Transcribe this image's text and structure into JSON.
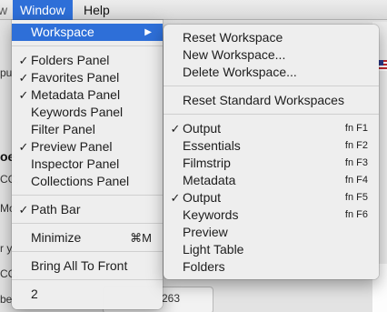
{
  "menubar": {
    "partial_item": "w",
    "items": [
      {
        "label": "Window"
      },
      {
        "label": "Help"
      }
    ]
  },
  "background": {
    "frag1": "pu",
    "frag2": "oe",
    "frag3": "CC,",
    "frag4": "Mo",
    "frag5": "r y",
    "frag6": "CC,",
    "frag7": "be",
    "frag8": "263",
    "frag9": "- - -"
  },
  "window_menu": {
    "items": [
      {
        "label": "Workspace",
        "checked": false,
        "shortcut": "",
        "submenu": true,
        "highlight": true
      },
      {
        "label": "Folders Panel",
        "checked": true,
        "shortcut": ""
      },
      {
        "label": "Favorites Panel",
        "checked": true,
        "shortcut": ""
      },
      {
        "label": "Metadata Panel",
        "checked": true,
        "shortcut": ""
      },
      {
        "label": "Keywords Panel",
        "checked": false,
        "shortcut": ""
      },
      {
        "label": "Filter Panel",
        "checked": false,
        "shortcut": ""
      },
      {
        "label": "Preview Panel",
        "checked": true,
        "shortcut": ""
      },
      {
        "label": "Inspector Panel",
        "checked": false,
        "shortcut": ""
      },
      {
        "label": "Collections Panel",
        "checked": false,
        "shortcut": ""
      },
      {
        "label": "Path Bar",
        "checked": true,
        "shortcut": ""
      },
      {
        "label": "Minimize",
        "checked": false,
        "shortcut": "⌘M"
      },
      {
        "label": "Bring All To Front",
        "checked": false,
        "shortcut": ""
      },
      {
        "label": "2",
        "checked": false,
        "shortcut": ""
      }
    ],
    "check_glyph": "✓",
    "submenu_glyph": "▶"
  },
  "workspace_submenu": {
    "items": [
      {
        "label": "Reset Workspace",
        "checked": false,
        "shortcut": ""
      },
      {
        "label": "New Workspace...",
        "checked": false,
        "shortcut": ""
      },
      {
        "label": "Delete Workspace...",
        "checked": false,
        "shortcut": ""
      },
      {
        "label": "Reset Standard Workspaces",
        "checked": false,
        "shortcut": ""
      },
      {
        "label": "Output",
        "checked": true,
        "shortcut": "fn F1"
      },
      {
        "label": "Essentials",
        "checked": false,
        "shortcut": "fn F2"
      },
      {
        "label": "Filmstrip",
        "checked": false,
        "shortcut": "fn F3"
      },
      {
        "label": "Metadata",
        "checked": false,
        "shortcut": "fn F4"
      },
      {
        "label": "Output",
        "checked": true,
        "shortcut": "fn F5"
      },
      {
        "label": "Keywords",
        "checked": false,
        "shortcut": "fn F6"
      },
      {
        "label": "Preview",
        "checked": false,
        "shortcut": ""
      },
      {
        "label": "Light Table",
        "checked": false,
        "shortcut": ""
      },
      {
        "label": "Folders",
        "checked": false,
        "shortcut": ""
      }
    ]
  },
  "colors": {
    "highlight": "#2e6fd8",
    "menu_bg": "#eeeeee"
  }
}
